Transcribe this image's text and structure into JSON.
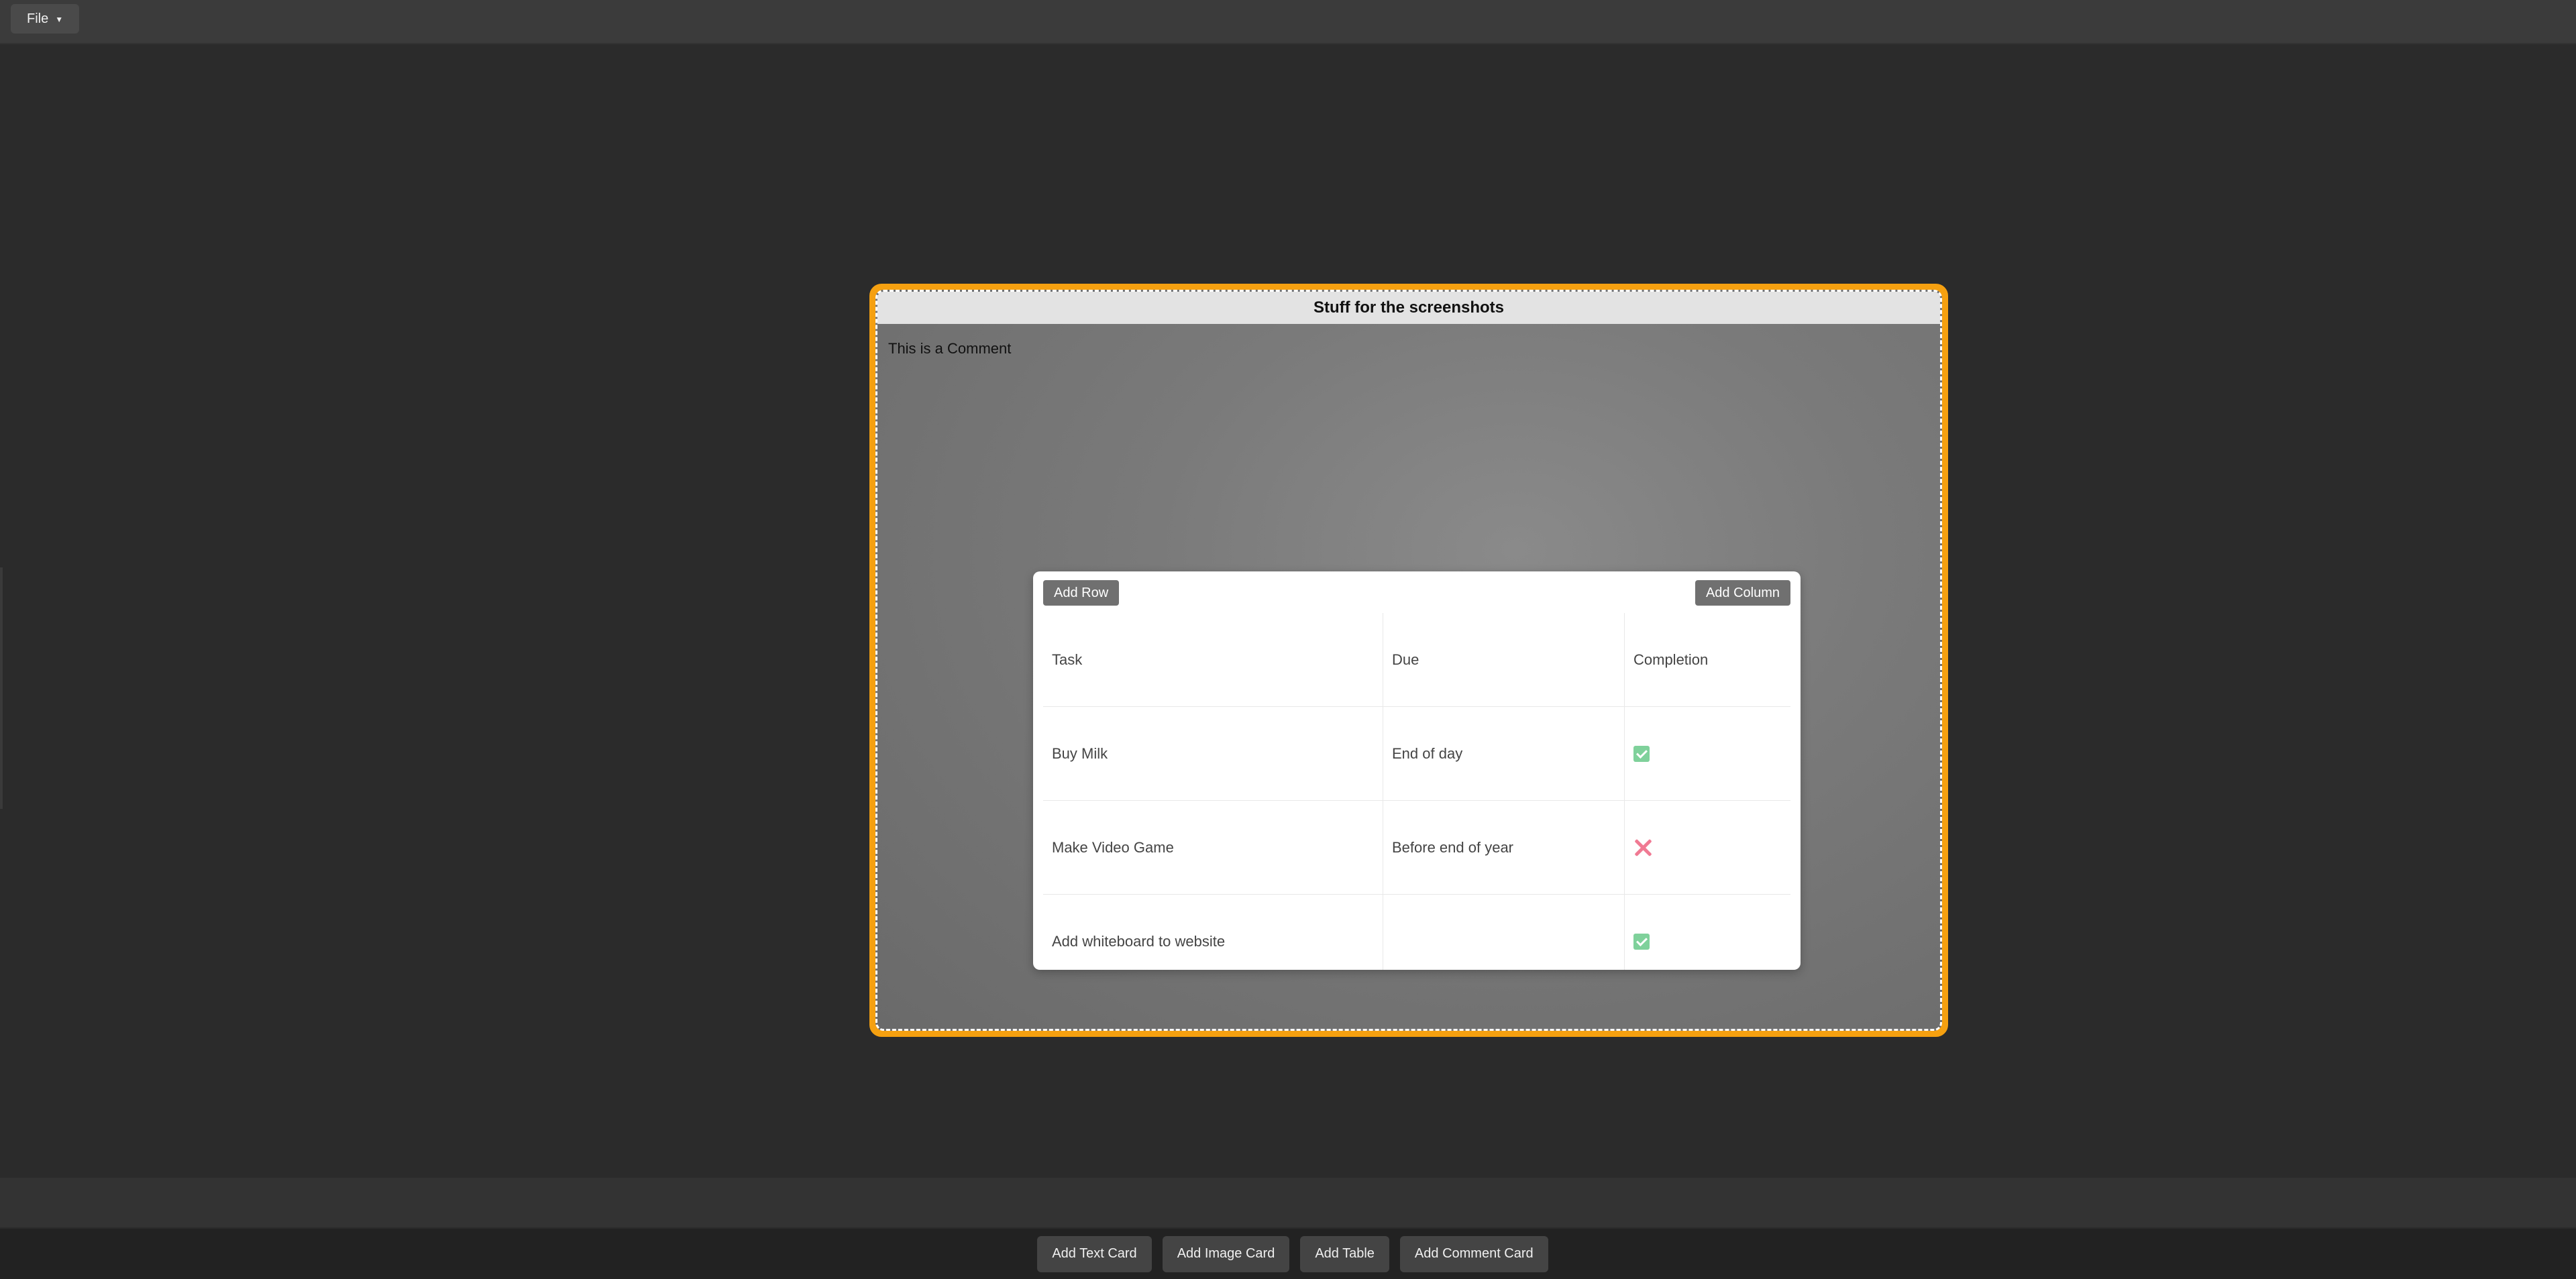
{
  "menubar": {
    "file_label": "File",
    "file_caret": "▼"
  },
  "comment_card": {
    "title": "Stuff for the screenshots",
    "comment_text": "This is a Comment",
    "border_color": "#f5a010"
  },
  "table": {
    "add_row_label": "Add Row",
    "add_column_label": "Add Column",
    "headers": [
      "Task",
      "Due",
      "Completion"
    ],
    "rows": [
      {
        "task": "Buy Milk",
        "due": "End of day",
        "completion": "check"
      },
      {
        "task": "Make Video Game",
        "due": "Before end of year",
        "completion": "cross"
      },
      {
        "task": "Add whiteboard to website",
        "due": "",
        "completion": "check"
      }
    ]
  },
  "toolbar": {
    "buttons": [
      "Add Text Card",
      "Add Image Card",
      "Add Table",
      "Add Comment Card"
    ]
  },
  "colors": {
    "check": "#7fd19b",
    "cross": "#f07a93",
    "accent": "#f5a010"
  }
}
